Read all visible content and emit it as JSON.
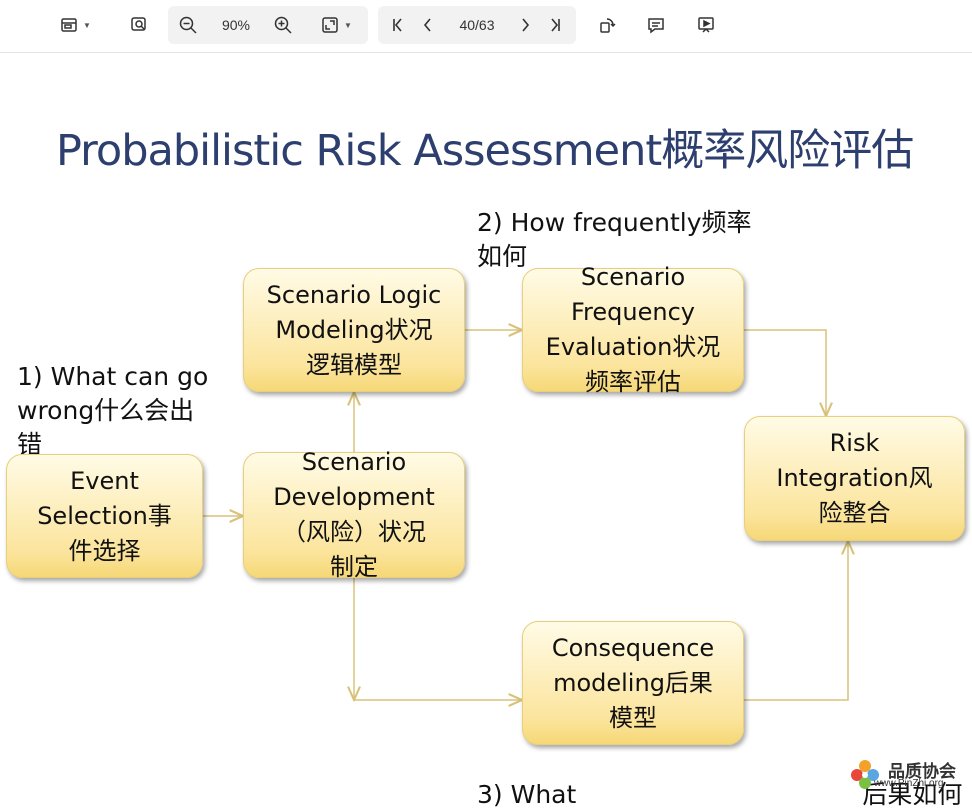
{
  "toolbar": {
    "zoom": "90%",
    "page": "40/63",
    "icons": [
      "sidebar-icon",
      "find-icon",
      "zoom-out-icon",
      "zoom-in-icon",
      "fit-page-icon",
      "first-page-icon",
      "prev-page-icon",
      "next-page-icon",
      "last-page-icon",
      "rotate-icon",
      "comment-icon",
      "present-icon"
    ]
  },
  "slide": {
    "title": "Probabilistic Risk Assessment概率风险评估",
    "note1": [
      "1) What can go",
      "wrong什么会出",
      "错"
    ],
    "note2": [
      "2) How frequently频率",
      "如何"
    ],
    "note3": "3) What                                    后果如何",
    "boxes": {
      "event": [
        "Event",
        "Selection事",
        "件选择"
      ],
      "scenario_logic": [
        "Scenario Logic",
        "Modeling状况",
        "逻辑模型"
      ],
      "scenario_dev": [
        "Scenario",
        "Development",
        "（风险）状况",
        "制定"
      ],
      "scenario_freq": [
        "Scenario",
        "Frequency",
        "Evaluation状况",
        "频率评估"
      ],
      "risk": [
        "Risk",
        "Integration风",
        "险整合"
      ],
      "consequence": [
        "Consequence",
        "modeling后果",
        "模型"
      ]
    }
  },
  "logo": {
    "name": "品质协会",
    "url": "www.PinZhi.org"
  },
  "colors": {
    "title": "#2d3f6e",
    "box_fill": "#fbe49c",
    "arrow": "#d8c27a"
  }
}
